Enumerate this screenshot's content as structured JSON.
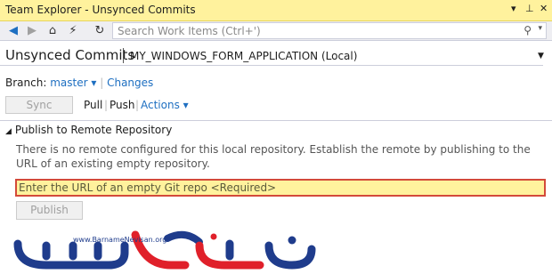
{
  "window": {
    "title": "Team Explorer - Unsynced Commits",
    "pin_glyph": "▾",
    "dock_glyph": "⊥",
    "close_glyph": "✕"
  },
  "toolbar": {
    "back_glyph": "◀",
    "forward_glyph": "▶",
    "home_glyph": "⌂",
    "connect_glyph": "⚡",
    "refresh_glyph": "↻",
    "search_placeholder": "Search Work Items (Ctrl+')",
    "search_icon_glyph": "⚲",
    "dropdown_glyph": "▾"
  },
  "header": {
    "page_title": "Unsynced Commits",
    "project": "MY_WINDOWS_FORM_APPLICATION (Local)",
    "dropdown_glyph": "▼"
  },
  "branch": {
    "label": "Branch:",
    "name": "master",
    "dropdown_glyph": "▾",
    "separator": "|",
    "changes_link": "Changes"
  },
  "actions": {
    "sync": "Sync",
    "pull": "Pull",
    "separator": "|",
    "push": "Push",
    "actions_menu": "Actions",
    "dropdown_glyph": "▾"
  },
  "publish_section": {
    "collapse_glyph": "◢",
    "title": "Publish to Remote Repository",
    "message": "There is no remote configured for this local repository. Establish the remote by publishing to the URL of an existing empty repository.",
    "url_placeholder": "Enter the URL of an empty Git repo <Required>",
    "publish_button": "Publish"
  },
  "watermark": {
    "url": "www.BarnameNevisan.org"
  },
  "colors": {
    "titlebar_bg": "#fff29d",
    "link": "#1e6fc1",
    "highlight_border": "#d34a3a",
    "logo_blue": "#1f3c8c",
    "logo_red": "#e0202a"
  }
}
